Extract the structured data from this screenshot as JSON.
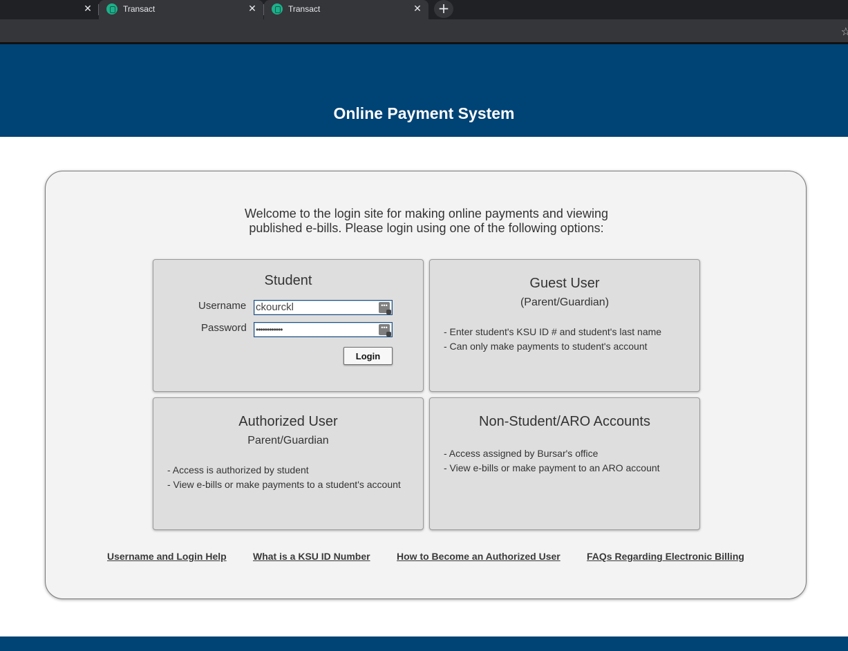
{
  "browser": {
    "tabs": [
      {
        "title": "Transact"
      },
      {
        "title": "Transact"
      }
    ],
    "close_glyph": "✕",
    "new_tab_glyph": "+",
    "bookmark_glyph": "☆"
  },
  "header": {
    "title": "Online Payment System"
  },
  "welcome": {
    "line1": "Welcome to the login site for making online payments and viewing",
    "line2": "published e-bills. Please login using one of the following options:"
  },
  "student": {
    "heading": "Student",
    "username_label": "Username",
    "username_value": "ckourckl",
    "password_label": "Password",
    "password_value": "••••••••••••",
    "login_button": "Login"
  },
  "guest": {
    "heading": "Guest User",
    "subheading": "(Parent/Guardian)",
    "items": [
      "- Enter student's KSU ID # and student's last name",
      "- Can only make payments to student's account"
    ]
  },
  "authorized": {
    "heading": "Authorized User",
    "subheading": "Parent/Guardian",
    "items": [
      "- Access is authorized by student",
      "- View e-bills or make payments to a student's account"
    ]
  },
  "nonstudent": {
    "heading": "Non-Student/ARO Accounts",
    "items": [
      "- Access assigned by Bursar's office",
      "- View e-bills or make payment to an ARO account"
    ]
  },
  "links": [
    {
      "label": "Username and Login Help"
    },
    {
      "label": "What is a KSU ID Number"
    },
    {
      "label": "How to Become an Authorized User"
    },
    {
      "label": "FAQs Regarding Electronic Billing"
    }
  ],
  "colors": {
    "header_blue": "#004375",
    "panel_bg": "#f3f3f3",
    "box_bg": "#dedede"
  }
}
